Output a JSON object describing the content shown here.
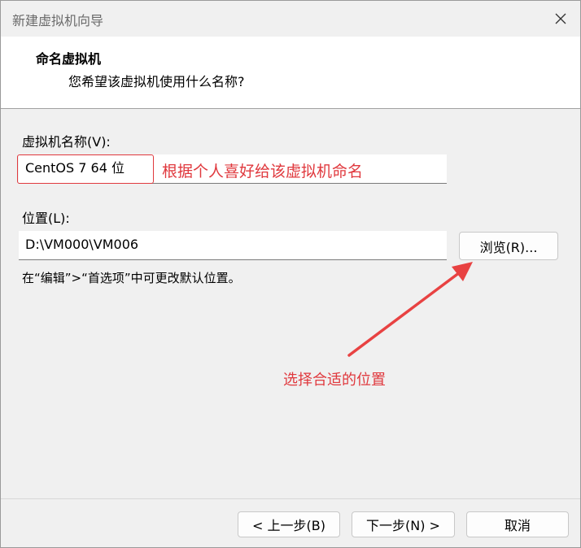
{
  "window": {
    "title": "新建虚拟机向导",
    "close_glyph": "✕"
  },
  "header": {
    "title": "命名虚拟机",
    "subtitle": "您希望该虚拟机使用什么名称?"
  },
  "vm_name": {
    "label": "虚拟机名称(V):",
    "value": "CentOS 7 64 位"
  },
  "location": {
    "label": "位置(L):",
    "value": "D:\\VM000\\VM006",
    "browse_label": "浏览(R)..."
  },
  "hint": "在“编辑”>“首选项”中可更改默认位置。",
  "annotations": {
    "name_note": "根据个人喜好给该虚拟机命名",
    "location_note": "选择合适的位置",
    "color": "#e0393e"
  },
  "footer": {
    "back_label": "< 上一步(B)",
    "next_label": "下一步(N) >",
    "cancel_label": "取消"
  }
}
